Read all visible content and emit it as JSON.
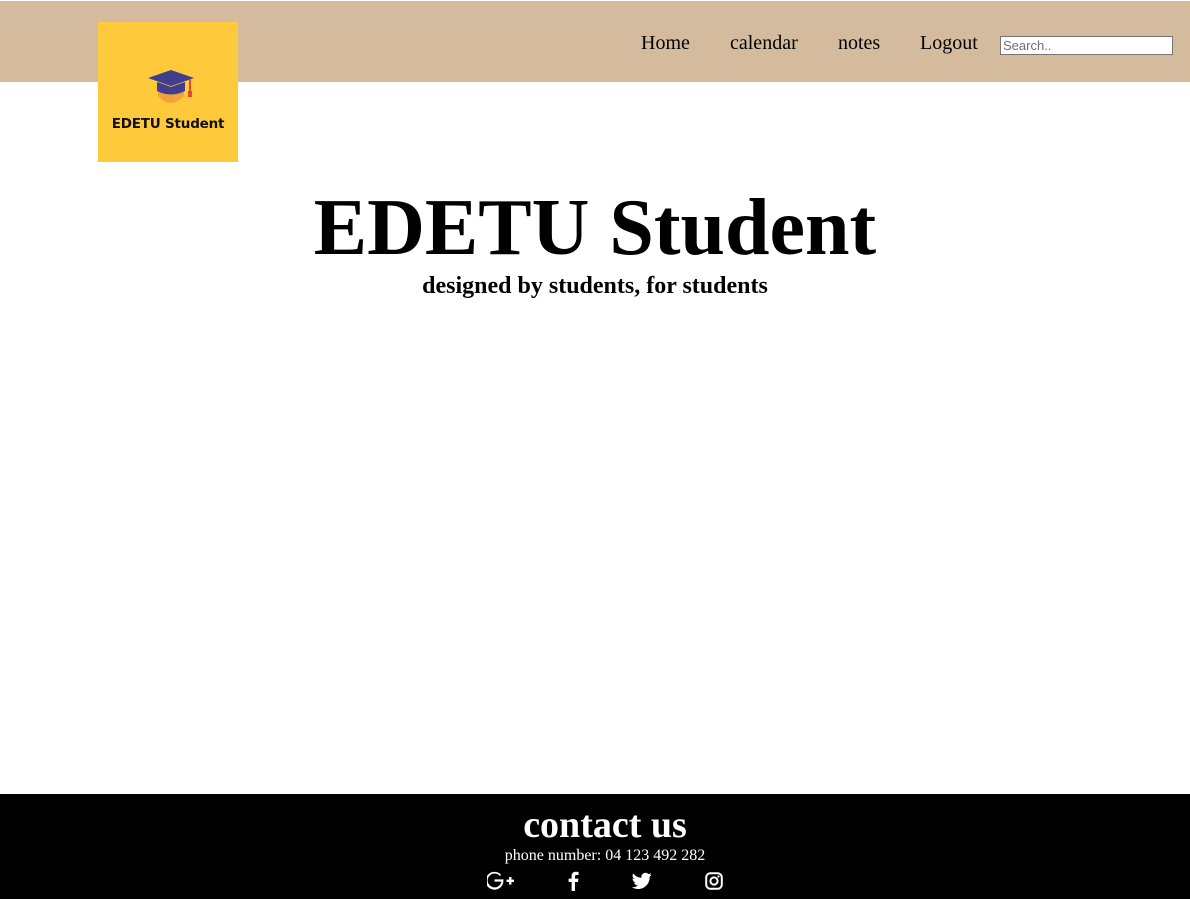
{
  "logo": {
    "text": "EDETU Student",
    "colors": {
      "background": "#ffc93c",
      "cap": "#3e3f8f",
      "shield": "#f4a23a",
      "tassel": "#e8462e"
    }
  },
  "nav": {
    "items": [
      {
        "label": "Home"
      },
      {
        "label": "calendar"
      },
      {
        "label": "notes"
      },
      {
        "label": "Logout"
      }
    ],
    "search": {
      "placeholder": "Search..",
      "value": ""
    }
  },
  "hero": {
    "title": "EDETU Student",
    "subtitle": "designed by students, for students"
  },
  "footer": {
    "title": "contact us",
    "phone": "phone number: 04 123 492 282",
    "social_icons": [
      "google-plus-icon",
      "facebook-icon",
      "twitter-icon",
      "instagram-icon"
    ]
  },
  "colors": {
    "header_bg": "#d5bb9d",
    "footer_bg": "#000000",
    "page_bg": "#ffffff"
  }
}
